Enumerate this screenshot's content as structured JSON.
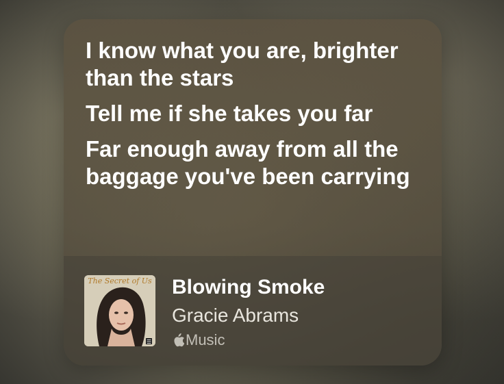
{
  "lyrics": {
    "lines": [
      "I know what you are, brighter than the stars",
      "Tell me if she takes you far",
      "Far enough away from all the baggage you've been carrying"
    ]
  },
  "track": {
    "title": "Blowing Smoke",
    "artist": "Gracie Abrams",
    "service": "Music",
    "artwork_text": "The Secret of Us"
  },
  "icons": {
    "service_logo": "apple-logo-icon"
  },
  "colors": {
    "card_background": "#5c5240",
    "text_primary": "#ffffff",
    "text_secondary": "#e9e6de"
  }
}
